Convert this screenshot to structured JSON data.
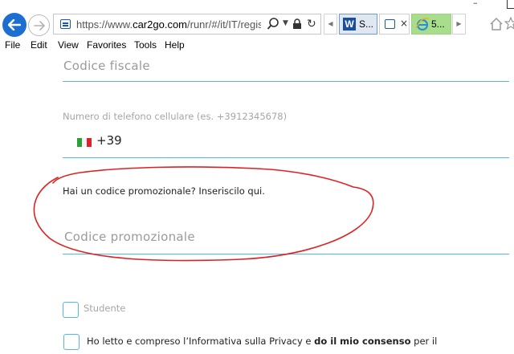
{
  "browser": {
    "url_prefix": "https://www.",
    "url_host": "car2go.com",
    "url_rest": "/runr/#/it/IT/registr",
    "tabs": [
      {
        "label": "S..."
      },
      {
        "label": "×"
      },
      {
        "label": "5..."
      }
    ],
    "window_min_label": "–",
    "menu": [
      "File",
      "Edit",
      "View",
      "Favorites",
      "Tools",
      "Help"
    ]
  },
  "form": {
    "fiscal_code_placeholder": "Codice fiscale",
    "phone_label": "Numero di telefono cellulare (es. +3912345678)",
    "phone_prefix": "+39",
    "promo_question": "Hai un codice promozionale? Inseriscilo qui.",
    "promo_placeholder": "Codice promozionale",
    "student_label": "Studente",
    "privacy_part1": "Ho letto e compreso l’Informativa sulla Privacy e ",
    "privacy_bold": "do il mio consenso",
    "privacy_part2": " per il"
  },
  "colors": {
    "accent": "#55b8de",
    "annotation": "#e02020",
    "back_button": "#1c6fd1"
  },
  "icons": [
    "back-arrow-icon",
    "forward-arrow-icon",
    "site-icon",
    "search-icon",
    "lock-icon",
    "refresh-icon",
    "ie-icon",
    "home-icon",
    "star-icon",
    "italy-flag-icon"
  ]
}
